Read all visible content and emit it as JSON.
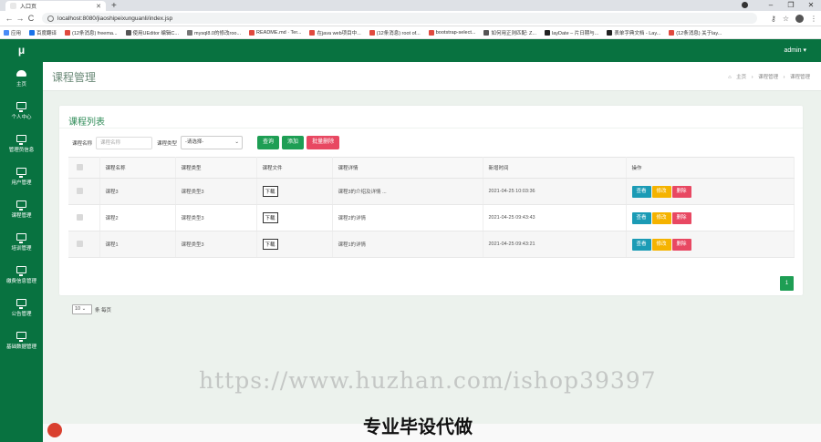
{
  "browser": {
    "tab_title": "入口页",
    "url": "localhost:8080/jiaoshipeixunguanli/index.jsp",
    "bookmarks": [
      "应用",
      "百度翻译",
      "(12条消息) freema...",
      "使用UEditor 编辑C...",
      "mysql8.0的修改roo...",
      "README.md · Ter...",
      "在java web项目中...",
      "(12条消息) root of...",
      "bootstrap-select...",
      "如何用正则匹配: Z...",
      "layDate – 片日期与...",
      "表单字典文档 - Lay...",
      "(12条消息) 关于lay..."
    ]
  },
  "app": {
    "logo": "μ",
    "user": "admin ▾",
    "sidebar": [
      {
        "label": "主页"
      },
      {
        "label": "个人中心"
      },
      {
        "label": "管理员信息"
      },
      {
        "label": "用户管理"
      },
      {
        "label": "课程管理"
      },
      {
        "label": "培训管理"
      },
      {
        "label": "缴费信息管理"
      },
      {
        "label": "公告管理"
      },
      {
        "label": "基础数据管理"
      }
    ],
    "page_title": "课程管理",
    "breadcrumb": [
      "主页",
      "课程管理",
      "课程管理"
    ],
    "card_title": "课程列表",
    "filters": {
      "name_label": "课程名称",
      "name_placeholder": "课程名称",
      "type_label": "课程类型",
      "type_value": "-请选择-",
      "query": "查询",
      "add": "添加",
      "batch_delete": "批量删除"
    },
    "table": {
      "headers": [
        "课程名称",
        "课程类型",
        "课程文件",
        "课程详情",
        "新增时间",
        "操作"
      ],
      "rows": [
        {
          "name": "课程3",
          "type": "课程类型3",
          "file": "下载",
          "detail": "课程3的介绍及详情 ...",
          "time": "2021-04-25 10:03:36"
        },
        {
          "name": "课程2",
          "type": "课程类型3",
          "file": "下载",
          "detail": "课程2的详情",
          "time": "2021-04-25 09:43:43"
        },
        {
          "name": "课程1",
          "type": "课程类型3",
          "file": "下载",
          "detail": "课程1的详情",
          "time": "2021-04-25 09:43:21"
        }
      ],
      "actions": {
        "view": "查看",
        "edit": "修改",
        "delete": "删除"
      }
    },
    "pager": {
      "page_size": "10",
      "per_page_text": "条 每页",
      "current_page": "1"
    }
  },
  "overlay": {
    "watermark": "https://www.huzhan.com/ishop39397",
    "slogan": "专业毕设代做"
  },
  "colors": {
    "brand": "#087240",
    "primary": "#1e9e54",
    "danger": "#e84862",
    "info": "#1b9bb5",
    "warning": "#f5b300"
  }
}
